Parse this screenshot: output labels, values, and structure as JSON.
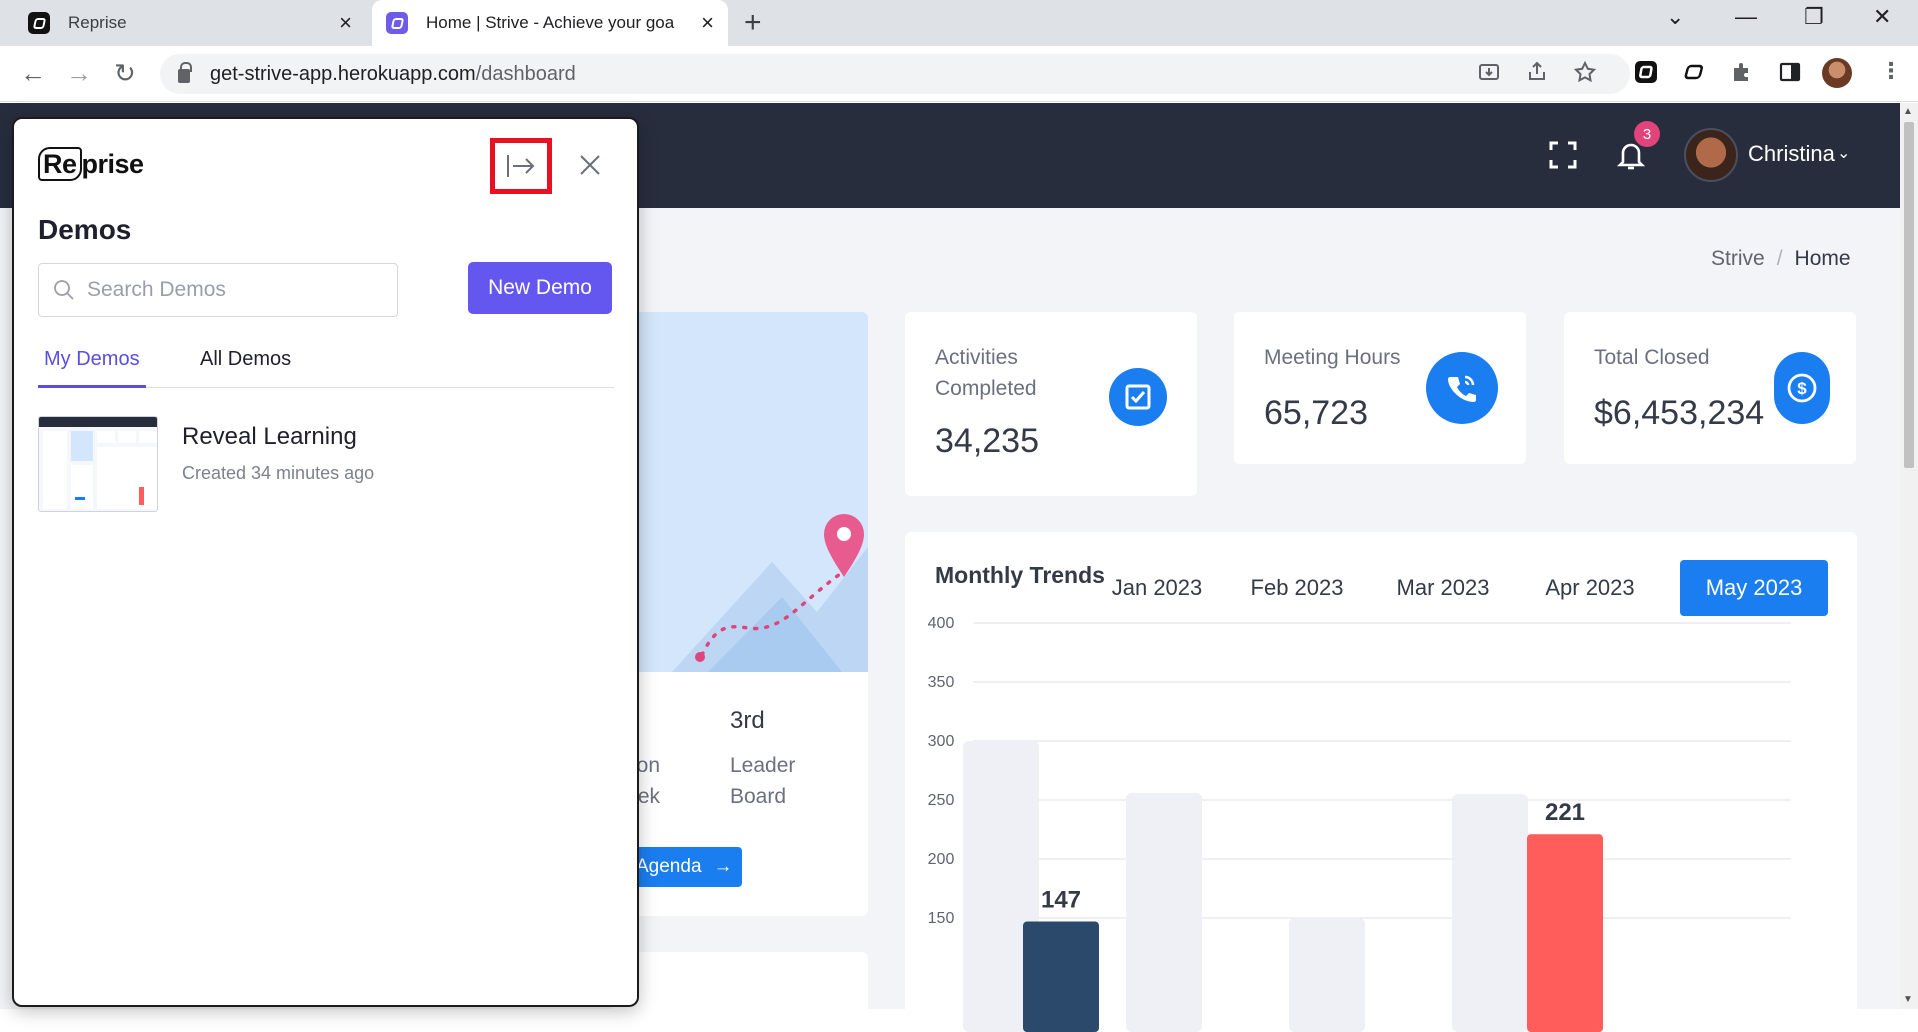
{
  "browser": {
    "tabs": [
      {
        "title": "Reprise",
        "active": false
      },
      {
        "title": "Home | Strive - Achieve your goa",
        "active": true
      }
    ],
    "new_tab_label": "+",
    "url_host": "get-strive-app.herokuapp.com",
    "url_path": "/dashboard"
  },
  "header": {
    "notification_count": "3",
    "user_name": "Christina"
  },
  "breadcrumb": {
    "root": "Strive",
    "separator": "/",
    "current": "Home"
  },
  "welcome": {
    "won_label": "won\neek",
    "rank_value": "3rd",
    "rank_label": "Leader Board",
    "agenda_button": "Agenda"
  },
  "stats": [
    {
      "label": "Activities Completed",
      "value": "34,235",
      "icon": "checkbox-icon"
    },
    {
      "label": "Meeting Hours",
      "value": "65,723",
      "icon": "phone-icon"
    },
    {
      "label": "Total Closed",
      "value": "$6,453,234",
      "icon": "dollar-icon"
    }
  ],
  "trends": {
    "title": "Monthly Trends",
    "months": [
      "Jan 2023",
      "Feb 2023",
      "Mar 2023",
      "Apr 2023",
      "May 2023"
    ],
    "active_month": "May 2023"
  },
  "chart_data": {
    "type": "bar",
    "y_ticks": [
      400,
      350,
      300,
      250,
      200,
      150
    ],
    "ylim": [
      150,
      400
    ],
    "background_bars": [
      300,
      256,
      150,
      255
    ],
    "series": [
      {
        "values": [
          147,
          221
        ],
        "labels": [
          "147",
          "221"
        ],
        "colors": [
          "#2b4a6b",
          "#ff5c5c"
        ]
      }
    ]
  },
  "reprise": {
    "logo_re": "Re",
    "logo_rest": "prise",
    "title": "Demos",
    "search_placeholder": "Search Demos",
    "new_demo_button": "New Demo",
    "tabs": [
      {
        "label": "My Demos",
        "active": true
      },
      {
        "label": "All Demos",
        "active": false
      }
    ],
    "demos": [
      {
        "name": "Reveal Learning",
        "meta": "Created 34 minutes ago"
      }
    ]
  },
  "colors": {
    "accent_blue": "#1a7df0",
    "reprise_purple": "#6457f0",
    "header_dark": "#282d3e",
    "highlight_red": "#e81123",
    "badge_pink": "#e0447a"
  }
}
